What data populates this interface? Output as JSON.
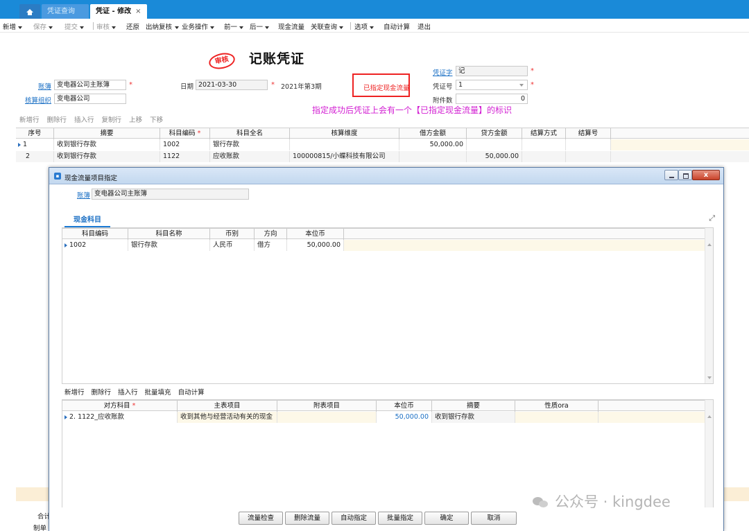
{
  "tabs": {
    "home_icon": "home-icon",
    "items": [
      {
        "label": "凭证查询"
      },
      {
        "label": "凭证 - 修改",
        "close": "×"
      }
    ]
  },
  "toolbar": {
    "new": "新增",
    "save": "保存",
    "submit": "提交",
    "audit": "审核",
    "restore": "还原",
    "cashier_review": "出纳复核",
    "business_ops": "业务操作",
    "prev": "前一",
    "next": "后一",
    "cash_flow": "现金流量",
    "related_query": "关联查询",
    "options": "选项",
    "auto_calc": "自动计算",
    "exit": "退出"
  },
  "voucher": {
    "stamp": "审核",
    "title": "记账凭证",
    "ledger_label": "账簿",
    "ledger_value": "变电器公司主账簿",
    "org_label": "核算组织",
    "org_value": "变电器公司",
    "date_label": "日期",
    "date_value": "2021-03-30",
    "period": "2021年第3期",
    "cash_flow_mark": "已指定现金流量",
    "word_label": "凭证字",
    "word_value": "记",
    "number_label": "凭证号",
    "number_value": "1",
    "attachments_label": "附件数",
    "attachments_value": "0",
    "note": "指定成功后凭证上会有一个【已指定现金流量】的标识"
  },
  "entry_toolbar": [
    "新增行",
    "删除行",
    "插入行",
    "复制行",
    "上移",
    "下移"
  ],
  "entries": {
    "headers": [
      "序号",
      "摘要",
      "科目编码",
      "科目全名",
      "核算维度",
      "借方金额",
      "贷方金额",
      "结算方式",
      "结算号"
    ],
    "rows": [
      {
        "seq": "1",
        "summary": "收到银行存款",
        "code": "1002",
        "name": "银行存款",
        "dimension": "",
        "debit": "50,000.00",
        "credit": ""
      },
      {
        "seq": "2",
        "summary": "收到银行存款",
        "code": "1122",
        "name": "应收账款",
        "dimension": "100000815/小蝶科技有限公司",
        "debit": "",
        "credit": "50,000.00"
      }
    ]
  },
  "footer_labels": {
    "total": "合计",
    "maker": "制单"
  },
  "dialog": {
    "title": "现金流量项目指定",
    "ledger_label": "账簿",
    "ledger_value": "变电器公司主账簿",
    "tab": "现金科目",
    "cash_headers": [
      "科目编码",
      "科目名称",
      "币别",
      "方向",
      "本位币"
    ],
    "cash_rows": [
      {
        "code": "1002",
        "name": "银行存款",
        "currency": "人民币",
        "direction": "借方",
        "amount": "50,000.00"
      }
    ],
    "sub_toolbar": [
      "新增行",
      "删除行",
      "插入行",
      "批量填充",
      "自动计算"
    ],
    "cp_headers": [
      "对方科目",
      "主表项目",
      "附表项目",
      "本位币",
      "摘要",
      "性质ora"
    ],
    "cp_rows": [
      {
        "account": "2. 1122_应收账款",
        "main_item": "收到其他与经营活动有关的现金",
        "sub_item": "",
        "amount": "50,000.00",
        "summary": "收到银行存款",
        "nature": ""
      }
    ],
    "buttons": [
      "流量检查",
      "删除流量",
      "自动指定",
      "批量指定",
      "确定",
      "取消"
    ],
    "close": "x"
  },
  "watermark": "公众号 · kingdee",
  "colors": {
    "tab_bar": "#1a8ad8",
    "stamp_red": "#e22222",
    "note_magenta": "#d21fd2",
    "link_blue": "#1a6fc4",
    "credit_blue": "#1a6fc4"
  }
}
